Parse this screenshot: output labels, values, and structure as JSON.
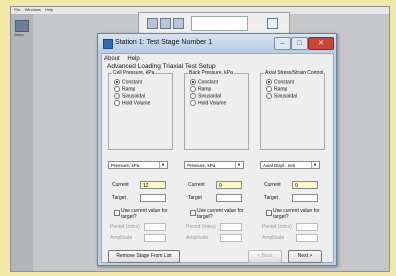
{
  "app_menu": [
    "File",
    "Windows",
    "Help"
  ],
  "side_icon_label": "Status",
  "dialog": {
    "title": "Station 1: Test Stage Number 1",
    "menu": [
      "About",
      "Help"
    ],
    "subtitle": "Advanced Loading Triaxial Test Setup",
    "groups": [
      {
        "label": "Cell Pressure, kPa",
        "options": [
          "Constant",
          "Ramp",
          "Sinusoidal",
          "Hold Volume"
        ],
        "selected": "Constant",
        "units": "Pressure, kPa",
        "current_label": "Current",
        "current_value": "12",
        "target_label": "Target",
        "use_current_label": "Use current value for target?",
        "period_label": "Period (mins)",
        "amplitude_label": "Amplitude"
      },
      {
        "label": "Back Pressure, kPa",
        "options": [
          "Constant",
          "Ramp",
          "Sinusoidal",
          "Hold Volume"
        ],
        "selected": "Constant",
        "units": "Pressure, kPa",
        "current_label": "Current",
        "current_value": "0",
        "target_label": "Target",
        "use_current_label": "Use current value for target?",
        "period_label": "Period (mins)",
        "amplitude_label": "Amplitude"
      },
      {
        "label": "Axial Stress/Strain Control",
        "options": [
          "Constant",
          "Ramp",
          "Sinusoidal"
        ],
        "selected": "Constant",
        "units": "Axial Displ., mm",
        "current_label": "Current",
        "current_value": "0",
        "target_label": "Target",
        "use_current_label": "Use current value for target?",
        "period_label": "Period (mins)",
        "amplitude_label": "Amplitude"
      }
    ],
    "buttons": {
      "remove": "Remove Stage From List",
      "back": "< Back",
      "next": "Next >"
    },
    "window_buttons": {
      "minimize": "–",
      "maximize": "□",
      "close": "✕"
    }
  }
}
